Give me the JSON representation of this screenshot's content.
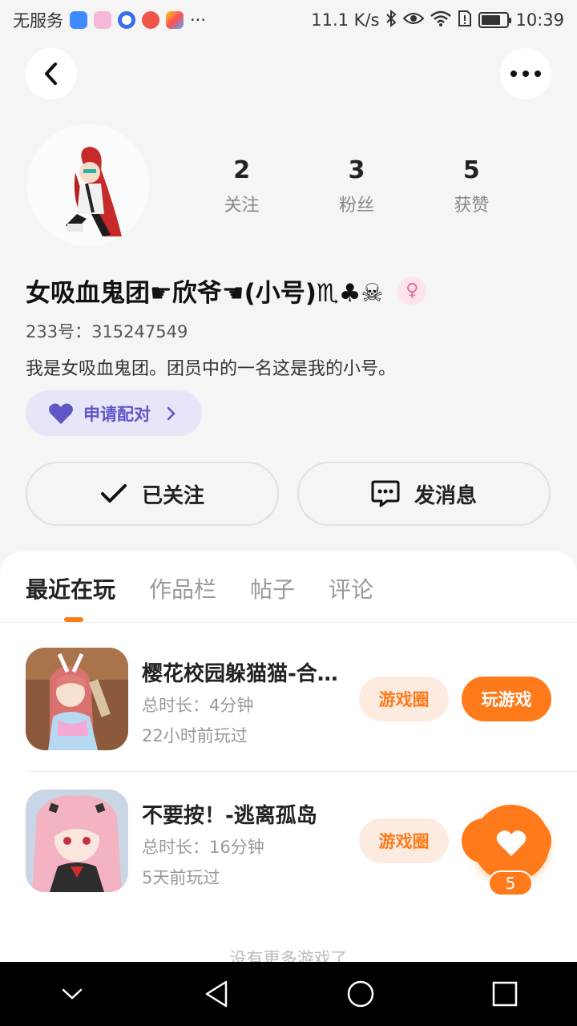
{
  "status_bar": {
    "carrier": "无服务",
    "more_dots": "···",
    "speed": "11.1 K/s",
    "time": "10:39",
    "battery_level": 0.75,
    "icons": [
      "shield-app-icon",
      "pink-app-icon",
      "blue-circle-app-icon",
      "red-app-icon",
      "colorful-app-icon",
      "bluetooth-icon",
      "eye-icon",
      "wifi-icon",
      "sim-alert-icon",
      "battery-icon"
    ]
  },
  "header": {
    "back_icon": "chevron-left-icon",
    "more_icon": "more-dots-icon"
  },
  "profile": {
    "stats": [
      {
        "num": "2",
        "label": "关注"
      },
      {
        "num": "3",
        "label": "粉丝"
      },
      {
        "num": "5",
        "label": "获赞"
      }
    ],
    "username": "女吸血鬼团☛欣爷☚(小号)♏♣☠",
    "gender_symbol": "♀",
    "user_id": "233号：315247549",
    "bio": "我是女吸血鬼团。团员中的一名这是我的小号。",
    "pair_label": "申请配对",
    "follow_label": "已关注",
    "message_label": "发消息"
  },
  "tabs": [
    {
      "label": "最近在玩",
      "active": true
    },
    {
      "label": "作品栏",
      "active": false
    },
    {
      "label": "帖子",
      "active": false
    },
    {
      "label": "评论",
      "active": false
    }
  ],
  "games": [
    {
      "name": "樱花校园躲猫猫-合…",
      "duration": "总时长：4分钟",
      "last_played": "22小时前玩过",
      "circle_label": "游戏圈",
      "play_label": "玩游戏"
    },
    {
      "name": "不要按！-逃离孤岛",
      "duration": "总时长：16分钟",
      "last_played": "5天前玩过",
      "circle_label": "游戏圈",
      "play_label": "玩游戏"
    }
  ],
  "no_more": "没有更多游戏了",
  "floating_like": {
    "count": "5"
  },
  "colors": {
    "accent": "#ff7a1a",
    "pair_bg": "#e7e5f8",
    "pair_text": "#5f56c7",
    "gender": "#e96a95"
  }
}
